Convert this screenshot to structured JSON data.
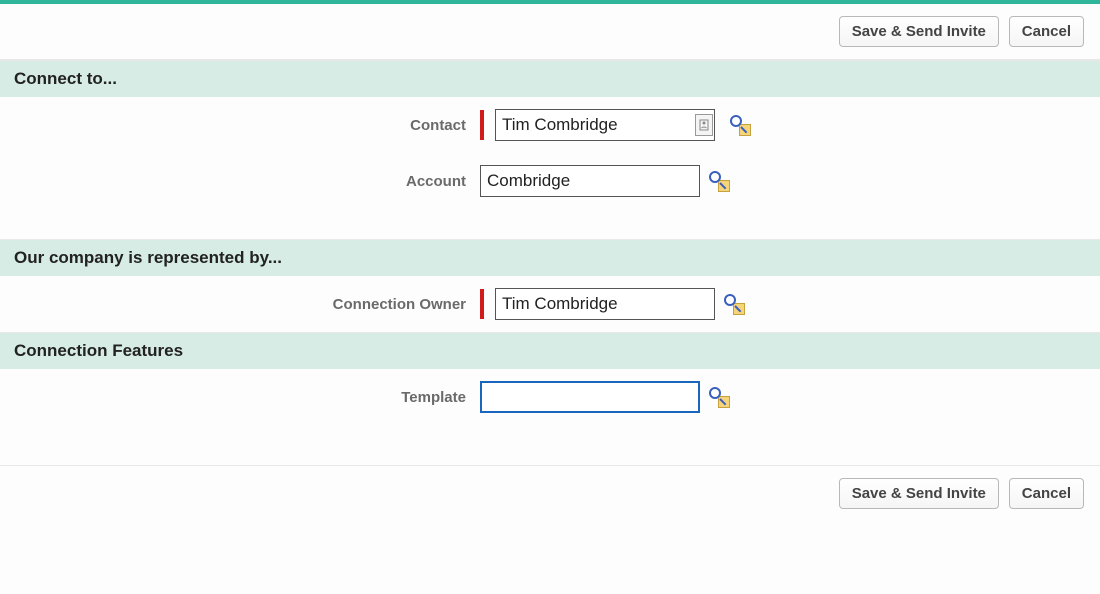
{
  "buttons": {
    "save_send": "Save & Send Invite",
    "cancel": "Cancel"
  },
  "sections": {
    "connect_to": "Connect to...",
    "represented_by": "Our company is represented by...",
    "connection_features": "Connection Features"
  },
  "fields": {
    "contact": {
      "label": "Contact",
      "value": "Tim Combridge"
    },
    "account": {
      "label": "Account",
      "value": "Combridge"
    },
    "connection_owner": {
      "label": "Connection Owner",
      "value": "Tim Combridge"
    },
    "template": {
      "label": "Template",
      "value": ""
    }
  }
}
